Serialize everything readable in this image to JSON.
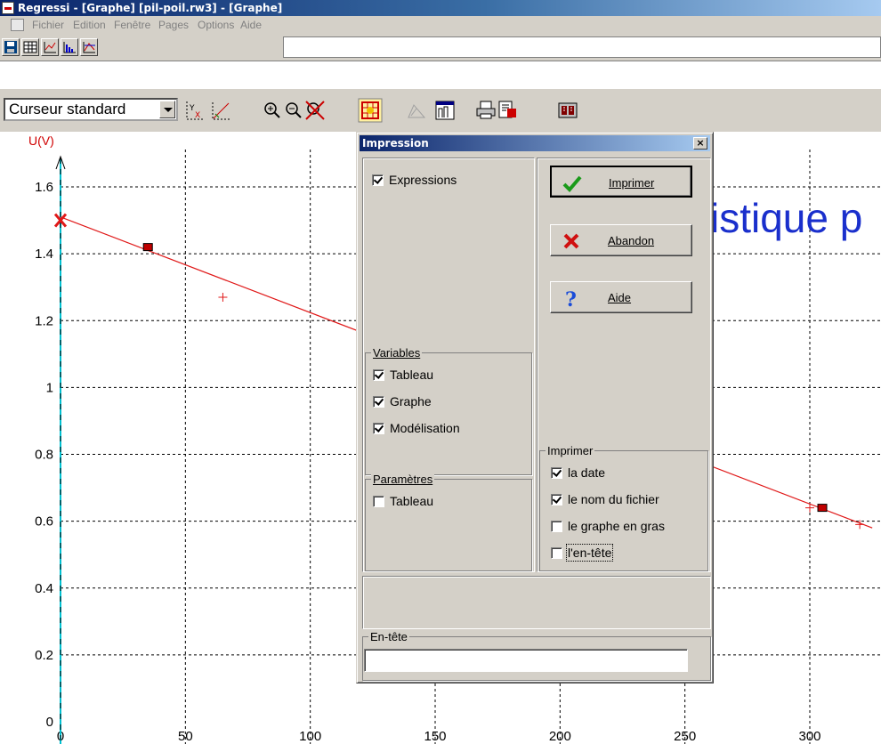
{
  "window": {
    "title": "Regressi  - [Graphe] [pil-poil.rw3] - [Graphe]"
  },
  "menubar": {
    "items": [
      "Fichier",
      "Edition",
      "Fenêtre",
      "Pages",
      "Options",
      "Aide"
    ]
  },
  "toolbar2": {
    "cursor_mode": "Curseur standard"
  },
  "graph": {
    "ylabel": "U(V)",
    "title_fragment": "istique p",
    "y_ticks": [
      "0",
      "0.2",
      "0.4",
      "0.6",
      "0.8",
      "1",
      "1.2",
      "1.4",
      "1.6"
    ],
    "x_ticks": [
      "0",
      "50",
      "100",
      "150",
      "200",
      "250",
      "300"
    ],
    "colors": {
      "curve": "#e01818",
      "axis": "#00c0d0",
      "title": "#1a2fcc"
    }
  },
  "chart_data": {
    "type": "scatter",
    "title": "",
    "xlabel": "",
    "ylabel": "U(V)",
    "xlim": [
      0,
      325
    ],
    "ylim": [
      0,
      1.6
    ],
    "grid": true,
    "series": [
      {
        "values_xy": [
          [
            0,
            1.5
          ],
          [
            35,
            1.42
          ],
          [
            65,
            1.27
          ],
          [
            300,
            0.64
          ],
          [
            305,
            0.64
          ],
          [
            320,
            0.59
          ]
        ]
      }
    ],
    "model_line": [
      [
        0,
        1.51
      ],
      [
        325,
        0.58
      ]
    ]
  },
  "dialog": {
    "title": "Impression",
    "close_label": "×",
    "expressions": {
      "label": "Expressions",
      "checked": true
    },
    "variables": {
      "legend": "Variables",
      "items": [
        {
          "label": "Tableau",
          "checked": true
        },
        {
          "label": "Graphe",
          "checked": true
        },
        {
          "label": "Modélisation",
          "checked": true
        }
      ]
    },
    "parametres": {
      "legend": "Paramètres",
      "items": [
        {
          "label": "Tableau",
          "checked": false
        }
      ]
    },
    "buttons": {
      "print": "Imprimer",
      "abort": "Abandon",
      "help": "Aide"
    },
    "imprimer": {
      "legend": "Imprimer",
      "items": [
        {
          "label": "la date",
          "checked": true
        },
        {
          "label": "le nom du fichier",
          "checked": true
        },
        {
          "label": "le graphe en gras",
          "checked": false
        },
        {
          "label": "l'en-tête",
          "checked": false
        }
      ]
    },
    "entete": {
      "legend": "En-tête",
      "value": ""
    }
  }
}
